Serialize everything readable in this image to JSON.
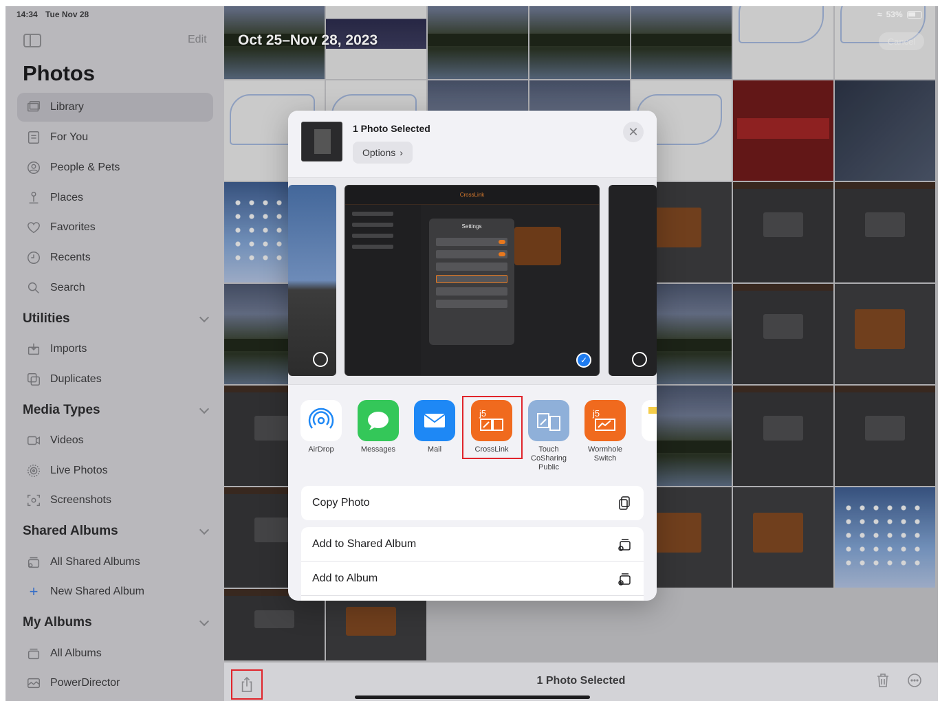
{
  "status": {
    "time": "14:34",
    "date": "Tue Nov 28",
    "battery": "53%"
  },
  "sidebar": {
    "edit": "Edit",
    "title": "Photos",
    "items": [
      {
        "label": "Library",
        "icon": "photo-library-icon",
        "active": true
      },
      {
        "label": "For You",
        "icon": "for-you-icon"
      },
      {
        "label": "People & Pets",
        "icon": "person-circle-icon"
      },
      {
        "label": "Places",
        "icon": "map-pin-icon"
      },
      {
        "label": "Favorites",
        "icon": "heart-icon"
      },
      {
        "label": "Recents",
        "icon": "clock-icon"
      },
      {
        "label": "Search",
        "icon": "search-icon"
      }
    ],
    "sections": {
      "utilities": {
        "title": "Utilities",
        "items": [
          {
            "label": "Imports",
            "icon": "import-icon"
          },
          {
            "label": "Duplicates",
            "icon": "duplicate-icon"
          }
        ]
      },
      "media_types": {
        "title": "Media Types",
        "items": [
          {
            "label": "Videos",
            "icon": "video-icon"
          },
          {
            "label": "Live Photos",
            "icon": "live-photo-icon"
          },
          {
            "label": "Screenshots",
            "icon": "screenshot-icon"
          }
        ]
      },
      "shared_albums": {
        "title": "Shared Albums",
        "items": [
          {
            "label": "All Shared Albums",
            "icon": "shared-album-icon"
          },
          {
            "label": "New Shared Album",
            "icon": "plus-icon"
          }
        ]
      },
      "my_albums": {
        "title": "My Albums",
        "items": [
          {
            "label": "All Albums",
            "icon": "album-icon"
          },
          {
            "label": "PowerDirector",
            "icon": "album-thumbnail-icon"
          }
        ]
      }
    }
  },
  "grid": {
    "date_range": "Oct 25–Nov 28, 2023",
    "cancel": "Cancel"
  },
  "toolbar": {
    "title": "1 Photo Selected"
  },
  "share_sheet": {
    "title": "1 Photo Selected",
    "options": "Options",
    "preview_app_title": "CrossLink",
    "preview_dialog_title": "Settings",
    "apps": [
      {
        "label": "AirDrop",
        "icon": "airdrop-icon",
        "color": "#ffffff"
      },
      {
        "label": "Messages",
        "icon": "messages-icon",
        "color": "#34c759"
      },
      {
        "label": "Mail",
        "icon": "mail-icon",
        "color": "#1e88f5"
      },
      {
        "label": "CrossLink",
        "icon": "crosslink-app-icon",
        "color": "#f06a1e",
        "highlighted": true
      },
      {
        "label": "Touch\nCoSharing\nPublic",
        "icon": "touch-cosharing-app-icon",
        "color": "#8fb0d9"
      },
      {
        "label": "Wormhole\nSwitch",
        "icon": "wormhole-switch-app-icon",
        "color": "#f06a1e"
      }
    ],
    "actions": [
      {
        "label": "Copy Photo",
        "icon": "copy-icon"
      },
      {
        "label": "Add to Shared Album",
        "icon": "shared-album-add-icon"
      },
      {
        "label": "Add to Album",
        "icon": "album-add-icon"
      }
    ]
  },
  "colors": {
    "highlight": "#e0242b",
    "accent": "#1f7cf0",
    "brand_orange": "#f06a1e"
  }
}
